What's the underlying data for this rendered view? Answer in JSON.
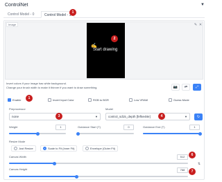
{
  "header": {
    "title": "ControlNet",
    "collapse_icon": "caret-down-icon"
  },
  "tabs": [
    {
      "label": "Control Model - 0"
    },
    {
      "label": "Control Model - 1"
    }
  ],
  "image": {
    "label": "Image",
    "start_drawing": "Start drawing"
  },
  "help": {
    "line1": "Invert colors if your image has white background.",
    "line2": "Change your brush width to make it thinner if you want to draw something."
  },
  "checkboxes": {
    "enable": "Enable",
    "invert": "Invert Input Color",
    "rgb_bgr": "RGB to BGR",
    "low_vram": "Low VRAM",
    "guess": "Guess Mode"
  },
  "preprocessor": {
    "label": "Preprocessor",
    "value": "none"
  },
  "model": {
    "label": "Model",
    "value": "control_sd15_depth [fef5e48e]"
  },
  "weight": {
    "label": "Weight",
    "value": "1",
    "fraction": 0.5
  },
  "guidance_start": {
    "label": "Guidance Start (T)",
    "value": "0",
    "fraction": 0.0
  },
  "guidance_end": {
    "label": "Guidance End (T)",
    "value": "1",
    "fraction": 1.0
  },
  "resize_mode": {
    "label": "Resize Mode",
    "options": [
      "Just Resize",
      "Scale to Fit (Inner Fit)",
      "Envelope (Outer Fit)"
    ],
    "selected": "Scale to Fit (Inner Fit)"
  },
  "canvas_width": {
    "label": "Canvas Width",
    "value": "512",
    "fraction": 0.25
  },
  "canvas_height": {
    "label": "Canvas Height",
    "value": "768",
    "fraction": 0.375
  },
  "annotations": [
    "1",
    "1",
    "2",
    "3",
    "4",
    "5",
    "6",
    "7"
  ],
  "colors": {
    "accent": "#3b82f6",
    "badge": "#c81e1e"
  }
}
